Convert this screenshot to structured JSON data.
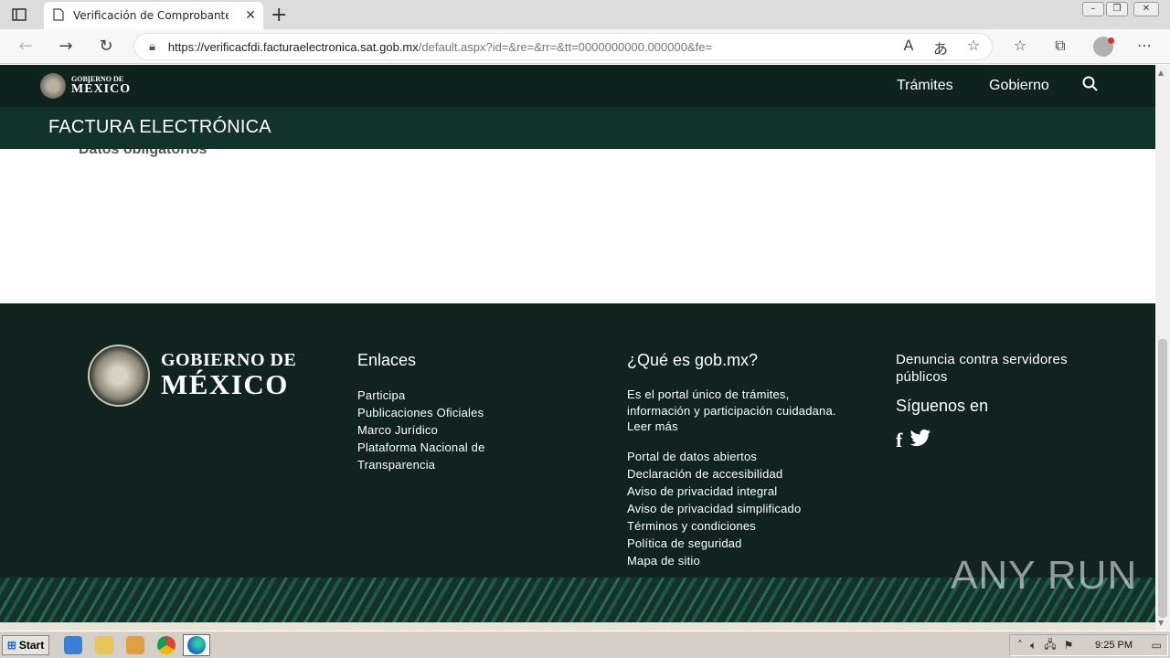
{
  "browser": {
    "tab_title": "Verificación de Comprobantes Fi",
    "url_host": "https://verificacfdi.facturaelectronica.sat.gob.mx",
    "url_path": "/default.aspx?id=&re=&rr=&tt=0000000000.000000&fe="
  },
  "header": {
    "logo_line1": "GOBIERNO DE",
    "logo_line2": "MÉXICO",
    "nav": [
      "Trámites",
      "Gobierno"
    ]
  },
  "subheader": {
    "title": "FACTURA ELECTRÓNICA"
  },
  "content": {
    "cut_text": "Datos obligatorios"
  },
  "footer": {
    "logo_line1": "GOBIERNO DE",
    "logo_line2": "MÉXICO",
    "enlaces": {
      "heading": "Enlaces",
      "links": [
        "Participa",
        "Publicaciones Oficiales",
        "Marco Jurídico",
        "Plataforma Nacional de Transparencia"
      ]
    },
    "que_es": {
      "heading": "¿Qué es gob.mx?",
      "paragraph": "Es el portal único de trámites, información y participación cuidadana. Leer más",
      "links": [
        "Portal de datos abiertos",
        "Declaración de accesibilidad",
        "Aviso de privacidad integral",
        "Aviso de privacidad simplificado",
        "Términos y condiciones",
        "Política de seguridad",
        "Mapa de sitio"
      ]
    },
    "denuncia": "Denuncia contra servidores públicos",
    "siguenos": "Síguenos en"
  },
  "watermark": "ANY RUN",
  "taskbar": {
    "start": "Start",
    "clock": "9:25 PM"
  }
}
